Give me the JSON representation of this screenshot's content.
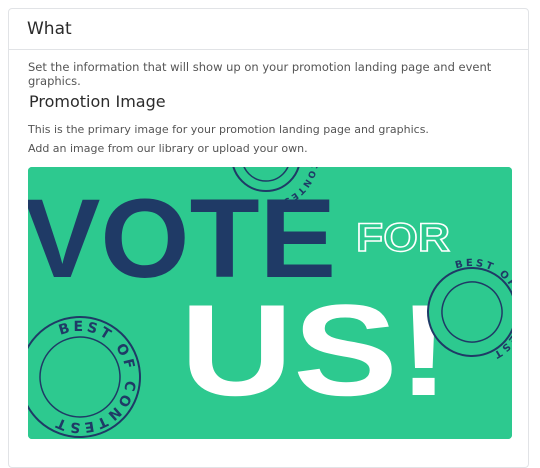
{
  "section": {
    "title": "What"
  },
  "description": "Set the information that will show up on your promotion landing page and event graphics.",
  "promotion_image": {
    "title": "Promotion Image",
    "helper_line1": "This is the primary image for your promotion landing page and graphics.",
    "helper_line2": "Add an image from our library or upload your own.",
    "graphic": {
      "word1": "VOTE",
      "word2": "FOR",
      "word3": "US!",
      "badge_text": "BEST OF CONTEST",
      "colors": {
        "background": "#2dc98f",
        "navy": "#1f3a66",
        "white": "#ffffff"
      }
    }
  }
}
